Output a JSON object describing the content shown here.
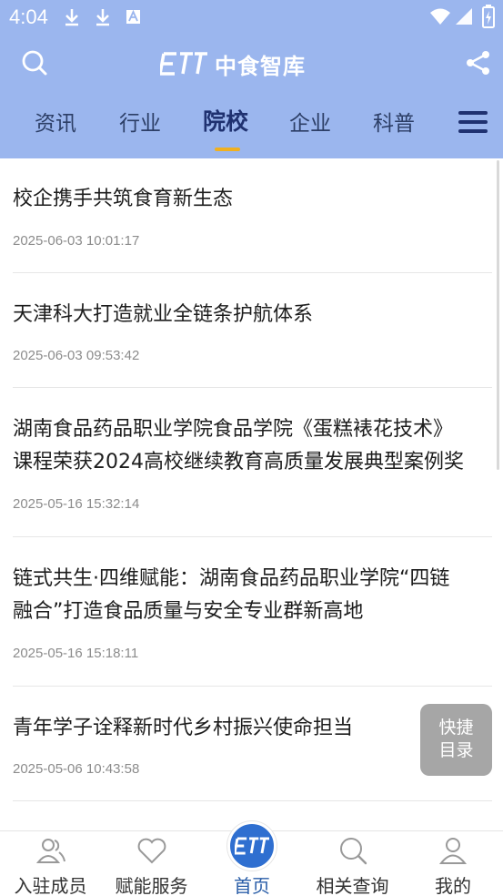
{
  "status_bar": {
    "time": "4:04"
  },
  "header": {
    "logo_text": "中食智库"
  },
  "tabs": [
    {
      "label": "资讯"
    },
    {
      "label": "行业"
    },
    {
      "label": "院校",
      "active": true
    },
    {
      "label": "企业"
    },
    {
      "label": "科普"
    }
  ],
  "articles": [
    {
      "title": "校企携手共筑食育新生态",
      "time": "2025-06-03 10:01:17"
    },
    {
      "title": "天津科大打造就业全链条护航体系",
      "time": "2025-06-03 09:53:42"
    },
    {
      "title_line1": "湖南食品药品职业学院食品学院《蛋糕裱花技术》",
      "title_line2": "课程荣获2024高校继续教育高质量发展典型案例奖",
      "time": "2025-05-16 15:32:14"
    },
    {
      "title_line1": "链式共生·四维赋能：湖南食品药品职业学院“四链",
      "title_line2": "融合”打造食品质量与安全专业群新高地",
      "time": "2025-05-16 15:18:11"
    },
    {
      "title": "青年学子诠释新时代乡村振兴使命担当",
      "time": "2025-05-06 10:43:58"
    }
  ],
  "quick_button": {
    "line1": "快捷",
    "line2": "目录"
  },
  "bottom_nav": [
    {
      "label": "入驻成员",
      "icon": "members-icon"
    },
    {
      "label": "赋能服务",
      "icon": "heart-icon"
    },
    {
      "label": "首页",
      "icon": "home-logo-icon",
      "active": true
    },
    {
      "label": "相关查询",
      "icon": "search-icon"
    },
    {
      "label": "我的",
      "icon": "profile-icon"
    }
  ],
  "colors": {
    "header_bg": "#9bb6ee",
    "accent": "#2f6fd0",
    "tab_underline": "#f0b020"
  }
}
